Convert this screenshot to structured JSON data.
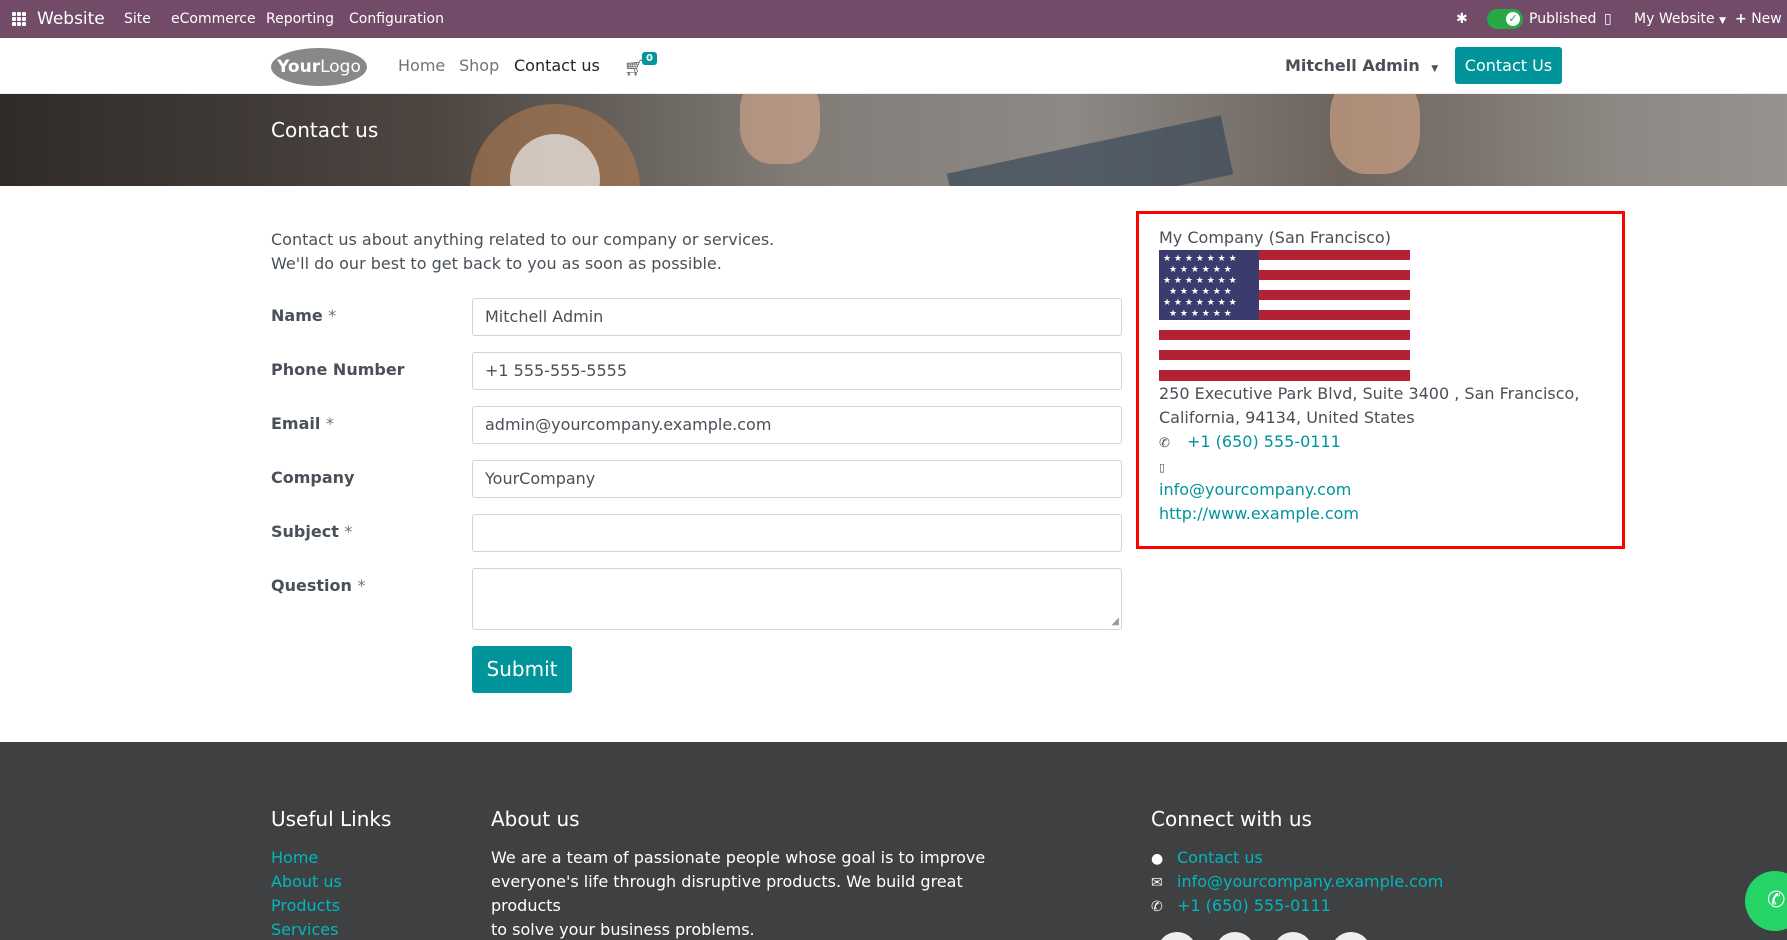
{
  "topbar": {
    "app_name": "Website",
    "menu": [
      "Site",
      "eCommerce",
      "Reporting",
      "Configuration"
    ],
    "published_label": "Published",
    "website_label": "My Website",
    "new_label": "New"
  },
  "navbar": {
    "logo_text_bold": "Your",
    "logo_text": "Logo",
    "links": [
      "Home",
      "Shop",
      "Contact us"
    ],
    "active_link": "Contact us",
    "cart_count": "0",
    "user": "Mitchell Admin",
    "cta": "Contact Us"
  },
  "banner": {
    "title": "Contact us"
  },
  "form": {
    "intro_line1": "Contact us about anything related to our company or services.",
    "intro_line2": "We'll do our best to get back to you as soon as possible.",
    "fields": [
      {
        "label": "Name",
        "required": "*",
        "value": "Mitchell Admin"
      },
      {
        "label": "Phone Number",
        "required": "",
        "value": "+1 555-555-5555"
      },
      {
        "label": "Email",
        "required": "*",
        "value": "admin@yourcompany.example.com"
      },
      {
        "label": "Company",
        "required": "",
        "value": "YourCompany"
      },
      {
        "label": "Subject",
        "required": "*",
        "value": ""
      },
      {
        "label": "Question",
        "required": "*",
        "value": ""
      }
    ],
    "submit": "Submit"
  },
  "company": {
    "name": "My Company (San Francisco)",
    "address_line1": "250 Executive Park Blvd, Suite 3400 , San Francisco,",
    "address_line2": "California, 94134, United States",
    "phone": "+1 (650) 555-0111",
    "mobile": "",
    "email": "info@yourcompany.com",
    "website": "http://www.example.com"
  },
  "footer": {
    "useful_links_title": "Useful Links",
    "useful_links": [
      "Home",
      "About us",
      "Products",
      "Services"
    ],
    "about_title": "About us",
    "about_line1": "We are a team of passionate people whose goal is to improve",
    "about_line2": "everyone's life through disruptive products. We build great products",
    "about_line3": "to solve your business problems.",
    "connect_title": "Connect with us",
    "connect_contact": "Contact us",
    "connect_email": "info@yourcompany.example.com",
    "connect_phone": "+1 (650) 555-0111"
  },
  "colors": {
    "topbar": "#714b67",
    "primary": "#01949a",
    "highlight": "#ff0000",
    "footer": "#3e4042"
  },
  "icons": [
    "apps-grid-icon",
    "bug-icon",
    "check-icon",
    "mobile-icon",
    "caret-down-icon",
    "plus-icon",
    "cart-icon",
    "phone-icon",
    "comment-icon",
    "envelope-icon",
    "whatsapp-icon",
    "us-flag-icon"
  ]
}
